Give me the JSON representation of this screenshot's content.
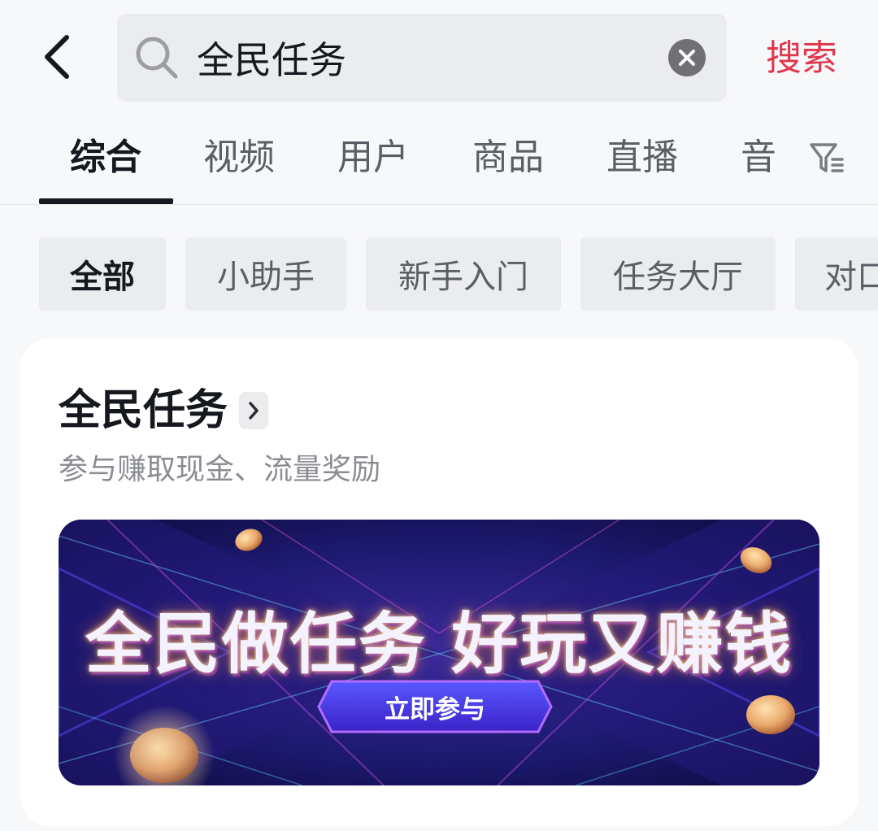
{
  "header": {
    "back_icon": "chevron-left-icon",
    "search_icon": "search-icon",
    "search_value": "全民任务",
    "clear_icon": "close-circle-icon",
    "search_button_label": "搜索"
  },
  "tabs": [
    {
      "label": "综合",
      "active": true
    },
    {
      "label": "视频",
      "active": false
    },
    {
      "label": "用户",
      "active": false
    },
    {
      "label": "商品",
      "active": false
    },
    {
      "label": "直播",
      "active": false
    },
    {
      "label": "音",
      "active": false
    }
  ],
  "filter_icon": "filter-icon",
  "chips": [
    {
      "label": "全部",
      "active": true
    },
    {
      "label": "小助手",
      "active": false
    },
    {
      "label": "新手入门",
      "active": false
    },
    {
      "label": "任务大厅",
      "active": false
    },
    {
      "label": "对口",
      "active": false
    }
  ],
  "card": {
    "title": "全民任务",
    "title_arrow_icon": "chevron-right-icon",
    "subtitle": "参与赚取现金、流量奖励",
    "banner": {
      "headline": "全民做任务 好玩又赚钱",
      "cta_label": "立即参与"
    }
  },
  "colors": {
    "accent": "#e2364c",
    "background": "#f7f8fa",
    "card": "#ffffff",
    "chip": "#ebecee",
    "text_primary": "#16181f",
    "text_secondary": "#8a8c93"
  }
}
